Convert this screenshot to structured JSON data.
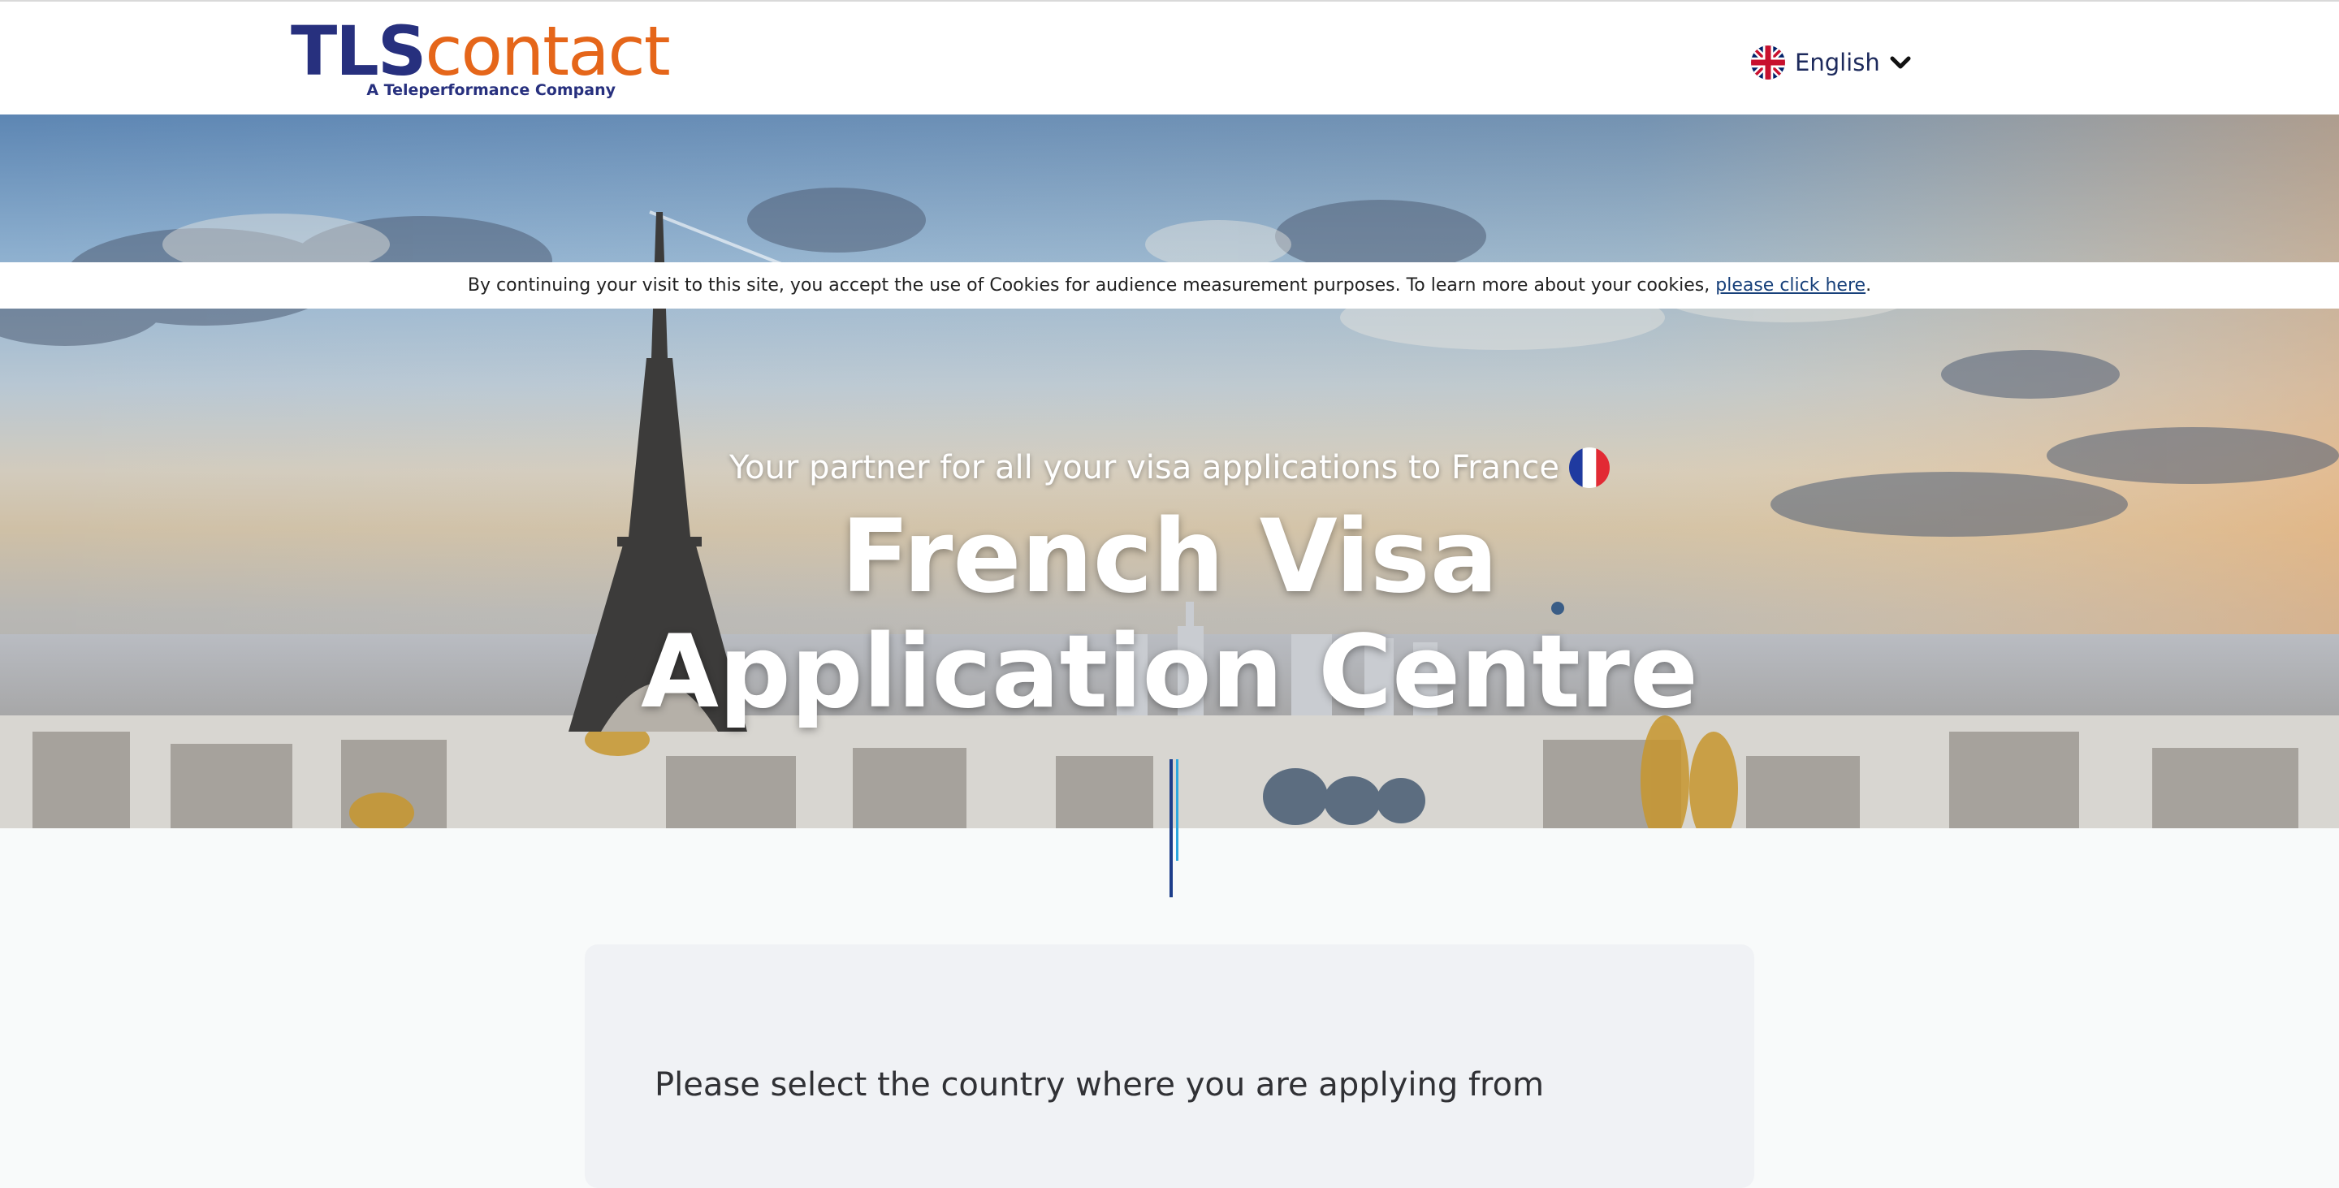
{
  "header": {
    "logo_brand_dark": "TLS",
    "logo_brand_light": "contact",
    "logo_subtitle": "A Teleperformance Company",
    "language": {
      "selected": "English",
      "flag_icon": "uk-flag-icon",
      "chevron_icon": "chevron-down-icon"
    }
  },
  "cookie_banner": {
    "text": "By continuing your visit to this site, you accept the use of Cookies for audience measurement purposes. To learn more about your cookies,",
    "link_text": "please click here",
    "period": "."
  },
  "hero": {
    "tagline": "Your partner for all your visa applications to France",
    "tagline_icon": "france-flag-icon",
    "title_line_1": "French Visa",
    "title_line_2": "Application Centre"
  },
  "country_panel": {
    "title": "Please select the country where you are applying from"
  },
  "colors": {
    "brand_dark": "#27307e",
    "brand_orange": "#e5661a",
    "divider_dark": "#1d3d8a",
    "divider_light": "#2ba6de"
  }
}
